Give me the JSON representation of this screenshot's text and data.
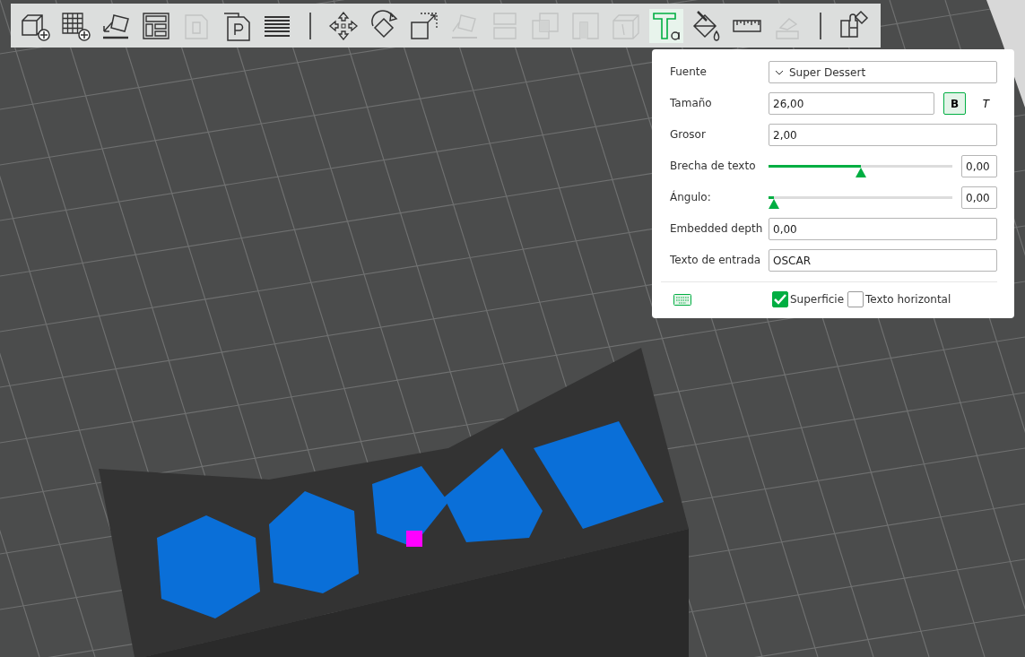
{
  "toolbar": {
    "tools": [
      {
        "kind": "add-object",
        "disabled": false,
        "selected": false
      },
      {
        "kind": "add-plate",
        "disabled": false,
        "selected": false
      },
      {
        "kind": "auto-orient",
        "disabled": false,
        "selected": false
      },
      {
        "kind": "arrange",
        "disabled": false,
        "selected": false
      },
      {
        "kind": "split",
        "disabled": true,
        "selected": false
      },
      {
        "kind": "plate-page",
        "disabled": false,
        "selected": false
      },
      {
        "kind": "layers",
        "disabled": false,
        "selected": false
      },
      {
        "kind": "separator"
      },
      {
        "kind": "move",
        "disabled": false,
        "selected": false
      },
      {
        "kind": "rotate",
        "disabled": false,
        "selected": false
      },
      {
        "kind": "scale",
        "disabled": false,
        "selected": false
      },
      {
        "kind": "lay-flat",
        "disabled": true,
        "selected": false
      },
      {
        "kind": "cut",
        "disabled": true,
        "selected": false
      },
      {
        "kind": "boolean",
        "disabled": true,
        "selected": false
      },
      {
        "kind": "support",
        "disabled": true,
        "selected": false
      },
      {
        "kind": "seam",
        "disabled": true,
        "selected": false
      },
      {
        "kind": "text",
        "disabled": false,
        "selected": true
      },
      {
        "kind": "paint",
        "disabled": false,
        "selected": false
      },
      {
        "kind": "measure",
        "disabled": false,
        "selected": false
      },
      {
        "kind": "assembly",
        "disabled": true,
        "selected": false
      },
      {
        "kind": "separator"
      },
      {
        "kind": "puzzle",
        "disabled": false,
        "selected": false
      }
    ]
  },
  "text_panel": {
    "rows": [
      {
        "kind": "dropdown",
        "label": "Fuente",
        "value": "Super Dessert"
      },
      {
        "kind": "size",
        "label": "Tamaño",
        "value": "26,00",
        "bold": {
          "label": "B",
          "selected": true
        },
        "italic": {
          "label": "T",
          "selected": false
        }
      },
      {
        "kind": "input",
        "label": "Grosor",
        "value": "2,00"
      },
      {
        "kind": "slider",
        "label": "Brecha de texto",
        "level": 0.5,
        "value": "0,00"
      },
      {
        "kind": "slider",
        "label": "Ángulo:",
        "level": 0.03,
        "value": "0,00"
      },
      {
        "kind": "input",
        "label": "Embedded depth",
        "value": "0,00"
      },
      {
        "kind": "input",
        "label": "Texto de entrada",
        "value": "OSCAR"
      }
    ],
    "options": [
      {
        "label": "Superficie",
        "checked": true
      },
      {
        "label": "Texto horizontal",
        "checked": false
      }
    ]
  }
}
